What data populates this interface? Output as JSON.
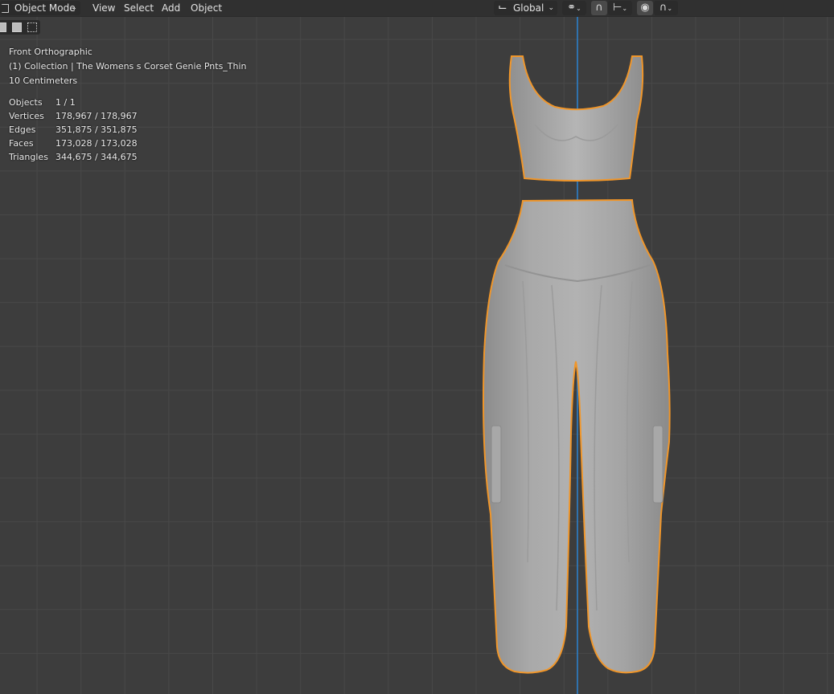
{
  "header": {
    "mode": "Object Mode",
    "menus": [
      "View",
      "Select",
      "Add",
      "Object"
    ],
    "orientation": "Global"
  },
  "overlay": {
    "view_name": "Front Orthographic",
    "collection": "(1) Collection | The Womens s Corset Genie Pnts_Thin",
    "scale": "10 Centimeters"
  },
  "stats": [
    {
      "label": "Objects",
      "value": "1 / 1"
    },
    {
      "label": "Vertices",
      "value": "178,967 / 178,967"
    },
    {
      "label": "Edges",
      "value": "351,875 / 351,875"
    },
    {
      "label": "Faces",
      "value": "173,028 / 173,028"
    },
    {
      "label": "Triangles",
      "value": "344,675 / 344,675"
    }
  ],
  "colors": {
    "viewport_bg": "#3d3d3d",
    "grid": "#484848",
    "selection_outline": "#f0962a",
    "y_axis": "#2e78b9",
    "mesh": "#a5a5a5"
  },
  "icons": [
    "square-mode-icon",
    "chevron-down-icon",
    "transform-orientation-icon",
    "pivot-point-icon",
    "snap-magnet-icon",
    "snap-target-icon",
    "proportional-edit-icon",
    "falloff-curve-icon"
  ]
}
